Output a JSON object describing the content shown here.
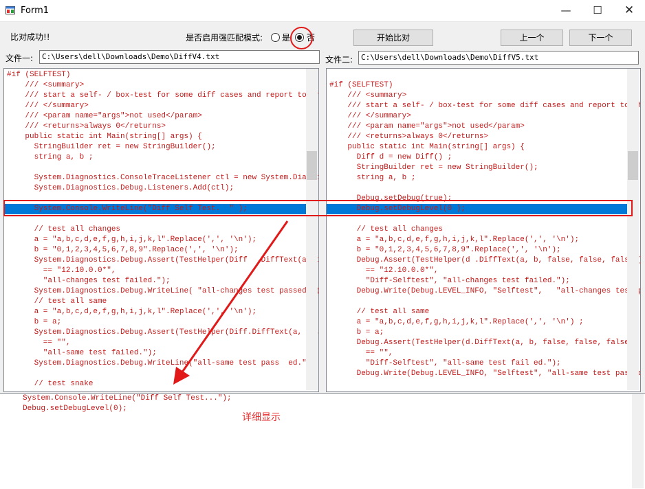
{
  "window": {
    "title": "Form1",
    "minimize_glyph": "—",
    "maximize_glyph": "☐",
    "close_glyph": "✕"
  },
  "status_text": "比对成功!!",
  "enhanced_mode": {
    "label": "是否启用强匹配模式:",
    "option_yes": "是",
    "option_no": "否",
    "selected": "否"
  },
  "buttons": {
    "start": "开始比对",
    "prev": "上一个",
    "next": "下一个"
  },
  "file1": {
    "label": "文件一:",
    "path": "C:\\Users\\dell\\Downloads\\Demo\\DiffV4.txt"
  },
  "file2": {
    "label": "文件二:",
    "path": "C:\\Users\\dell\\Downloads\\Demo\\DiffV5.txt"
  },
  "left_code": [
    "#if (SELFTEST)",
    "    /// <summary>",
    "    /// start a self- / box-test for some diff cases and report to the d",
    "    /// </summary>",
    "    /// <param name=\"args\">not used</param>",
    "    /// <returns>always 0</returns>",
    "    public static int Main(string[] args) {",
    "      StringBuilder ret = new StringBuilder();",
    "      string a, b ;",
    "",
    "      System.Diagnostics.ConsoleTraceListener ctl = new System.Diagnost",
    "      System.Diagnostics.Debug.Listeners.Add(ctl);",
    "",
    "      System.Console.WriteLine(\"Diff Self Test.  \" );",
    "",
    "      // test all changes",
    "      a = \"a,b,c,d,e,f,g,h,i,j,k,l\".Replace(',', '\\n');",
    "      b = \"0,1,2,3,4,5,6,7,8,9\".Replace(',', '\\n');",
    "      System.Diagnostics.Debug.Assert(TestHelper(Diff  .DiffText(a, b, fa",
    "        == \"12.10.0.0*\",",
    "        \"all-changes test failed.\");",
    "      System.Diagnostics.Debug.WriteLine( \"all-changes test passed.\");",
    "      // test all same",
    "      a = \"a,b,c,d,e,f,g,h,i,j,k,l\".Replace(',', '\\n');",
    "      b = a;",
    "      System.Diagnostics.Debug.Assert(TestHelper(Diff.DiffText(a,  b,  fal",
    "        == \"\",",
    "        \"all-same test failed.\");",
    "      System.Diagnostics.Debug.WriteLine(\"all-same test pass  ed.\");",
    "",
    "      // test snake"
  ],
  "left_selected_line": 13,
  "right_code": [
    "",
    "#if (SELFTEST)",
    "    /// <summary>",
    "    /// start a self- / box-test for some diff cases and report to the d",
    "    /// </summary>",
    "    /// <param name=\"args\">not used</param>",
    "    /// <returns>always 0</returns>",
    "    public static int Main(string[] args) {",
    "      Diff d = new Diff() ;",
    "      StringBuilder ret = new StringBuilder();",
    "      string a, b ;",
    "",
    "      Debug.setDebug(true);",
    "      Debug.setDebugLevel(0 );",
    "",
    "      // test all changes",
    "      a = \"a,b,c,d,e,f,g,h,i,j,k,l\".Replace(',', '\\n');",
    "      b = \"0,1,2,3,4,5,6,7,8,9\".Replace(',', '\\n');",
    "      Debug.Assert(TestHelper(d .DiffText(a, b, false, false, false))",
    "        == \"12.10.0.0*\",",
    "        \"Diff-Selftest\", \"all-changes test failed.\");",
    "      Debug.Write(Debug.LEVEL_INFO, \"Selftest\",   \"all-changes test passe",
    "",
    "      // test all same",
    "      a = \"a,b,c,d,e,f,g,h,i,j,k,l\".Replace(',', '\\n') ;",
    "      b = a;",
    "      Debug.Assert(TestHelper(d.DiffText(a, b, false, false, false))",
    "        == \"\",",
    "        \"Diff-Selftest\", \"all-same test fail ed.\");",
    "      Debug.Write(Debug.LEVEL_INFO, \"Selftest\", \"all-same test passed.\")"
  ],
  "right_selected_line": 13,
  "detail_lines": [
    "System.Console.WriteLine(\"Diff Self Test...\");",
    "Debug.setDebugLevel(0);"
  ],
  "annotation": {
    "text": "详细显示",
    "color": "#e63030"
  },
  "colors": {
    "selection": "#0078d7",
    "code_text": "#c41a1a",
    "annotation_red": "#e11919"
  }
}
